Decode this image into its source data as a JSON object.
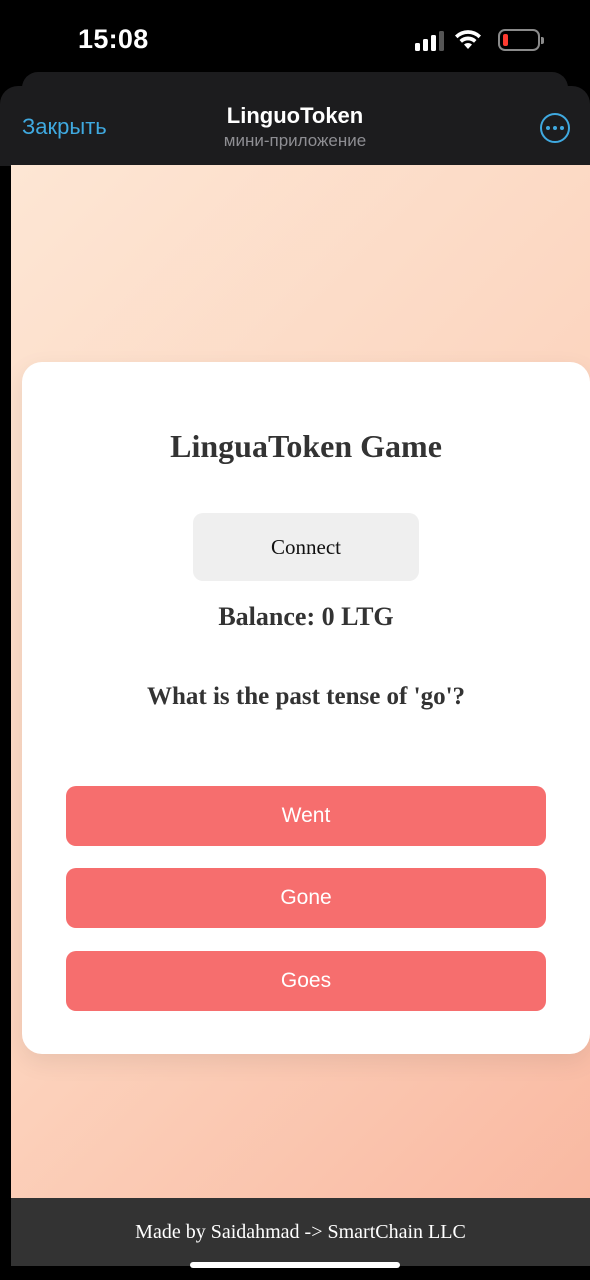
{
  "status_bar": {
    "time": "15:08",
    "battery_level": 0.1
  },
  "header": {
    "close_label": "Закрыть",
    "title": "LinguoToken",
    "subtitle": "мини-приложение",
    "more_icon": "more-dots-icon"
  },
  "game": {
    "title": "LinguaToken Game",
    "connect_label": "Connect",
    "balance": "Balance: 0 LTG",
    "question": "What is the past tense of 'go'?",
    "answers": [
      "Went",
      "Gone",
      "Goes"
    ]
  },
  "footer": {
    "text": "Made by Saidahmad -> SmartChain LLC"
  },
  "colors": {
    "accent": "#3fa9e0",
    "answer_button": "#f66e6e",
    "gradient_start": "#fde6d4",
    "gradient_end": "#f9b9a2",
    "footer_bg": "#333333"
  }
}
